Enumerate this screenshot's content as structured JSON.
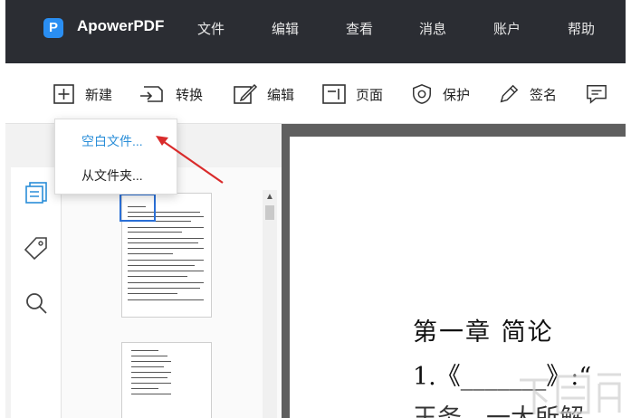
{
  "app": {
    "logo_letter": "P",
    "name": "ApowerPDF",
    "accent": "#2a8ef2"
  },
  "menubar": [
    "文件",
    "编辑",
    "查看",
    "消息",
    "账户",
    "帮助"
  ],
  "toolbar": {
    "new_label": "新建",
    "convert_label": "转换",
    "edit_label": "编辑",
    "page_label": "页面",
    "protect_label": "保护",
    "sign_label": "签名"
  },
  "new_menu": {
    "items": [
      {
        "label": "空白文件...",
        "state": "highlighted"
      },
      {
        "label": "从文件夹...",
        "state": "normal"
      }
    ]
  },
  "document": {
    "heading": "第一章  简论",
    "line1": "1.《_______》:“",
    "line2": "王务、一大所解"
  },
  "sidebar_icons": [
    "pages-icon",
    "bookmark-tag-icon",
    "search-icon"
  ]
}
